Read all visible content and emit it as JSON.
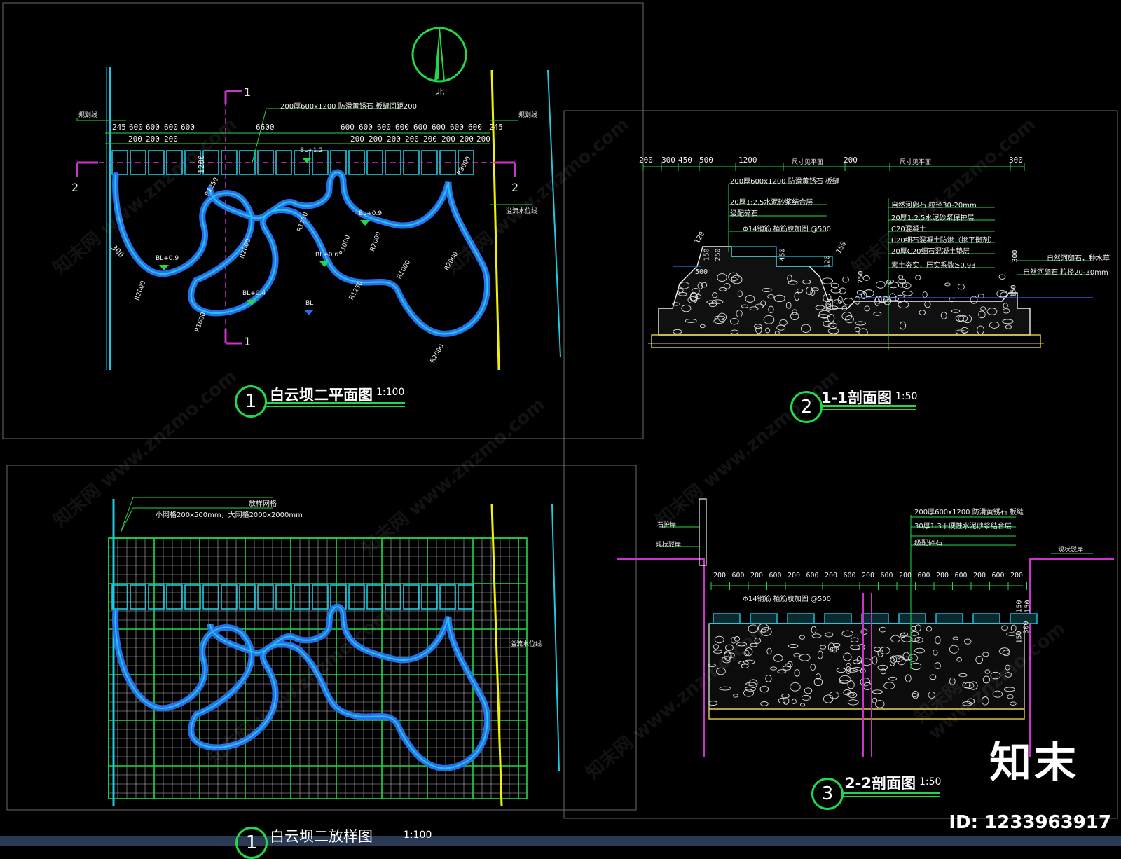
{
  "panels": {
    "plan": {
      "number": "1",
      "title": "白云坝二平面图",
      "scale": "1:100",
      "north_label": "北",
      "section_marks": [
        "1",
        "1",
        "2",
        "2"
      ],
      "top_note": "200厚600x1200 防滑黄锈石 板缝间距200",
      "left_tag": "规划线",
      "right_tag": "规划线",
      "water_tag": "溢流水位线",
      "dims_top_left": [
        "245",
        "600",
        "600",
        "600",
        "600"
      ],
      "dims_mid": "6600",
      "dims_top_right": [
        "600",
        "600",
        "600",
        "600",
        "600",
        "600",
        "600",
        "600"
      ],
      "dims_right_end": "245",
      "dims_bottom": [
        "200",
        "200",
        "200",
        "200",
        "200",
        "200",
        "200",
        "200",
        "200",
        "200",
        "200"
      ],
      "dim_1200": "1200",
      "elevations": [
        "BL+1.2",
        "BL+0.9",
        "BL+0.9",
        "BL+0.6",
        "BL+0.4",
        "BL"
      ],
      "radii": [
        "R1250",
        "R1750",
        "R1000",
        "R2000",
        "R2000",
        "R1600",
        "R2000",
        "R1000",
        "R1250",
        "R2000",
        "R2000",
        "R3000"
      ],
      "left_dim": "300"
    },
    "section11": {
      "number": "2",
      "title": "1-1剖面图",
      "scale": "1:50",
      "dims": [
        "200",
        "300",
        "450",
        "500",
        "1200",
        "尺寸见平面",
        "200",
        "尺寸见平面",
        "300"
      ],
      "notes_left": [
        "200厚600x1200 防滑黄锈石 板缝",
        "20厚1:2.5水泥砂浆结合层",
        "级配碎石",
        "Φ14钢筋 植筋胶加固 @500"
      ],
      "notes_right": [
        "自然河卵石 粒径30-20mm",
        "20厚1:2.5水泥砂浆保护层",
        "C20混凝土",
        "C20细石混凝土防渗（掺平衡剂）",
        "20厚C20细石混凝土垫层",
        "素土夯实，压实系数≥0.93"
      ],
      "side_notes": [
        "自然河卵石，种水草",
        "自然河卵石 粒径20-30mm"
      ],
      "vdims": [
        "120",
        "150",
        "250",
        "500",
        "450",
        "120",
        "750",
        "150",
        "150",
        "300"
      ]
    },
    "layout": {
      "number": "1",
      "title": "白云坝二放样图",
      "scale": "1:100",
      "note1": "放样网格",
      "note2": "小网格200x500mm，大网格2000x2000mm",
      "water_tag": "溢流水位线"
    },
    "section22": {
      "number": "3",
      "title": "2-2剖面图",
      "scale": "1:50",
      "notes_top": [
        "200厚600x1200 防滑黄锈石 板缝",
        "30厚1:3干硬性水泥砂浆结合层",
        "级配碎石"
      ],
      "rebar": "Φ14钢筋 植筋胶加固 @500",
      "left_tags": [
        "石护岸",
        "现状驳岸"
      ],
      "right_tag": "现状驳岸",
      "dims": [
        "200",
        "600",
        "200",
        "600",
        "200",
        "600",
        "200",
        "600",
        "200",
        "600",
        "200",
        "600",
        "200",
        "600",
        "200",
        "600",
        "200"
      ],
      "vdims": [
        "150",
        "150",
        "300",
        "150"
      ]
    }
  },
  "watermark": "知末网 www.znzmo.com",
  "brand": "知末",
  "image_id": "ID: 1233963917",
  "colors": {
    "bg": "#000000",
    "cyan": "#1fc9e0",
    "green": "#22d84a",
    "yellow": "#f2f200",
    "magenta": "#cc33cc",
    "blue": "#2a6ef0",
    "white": "#f0f0f0"
  }
}
